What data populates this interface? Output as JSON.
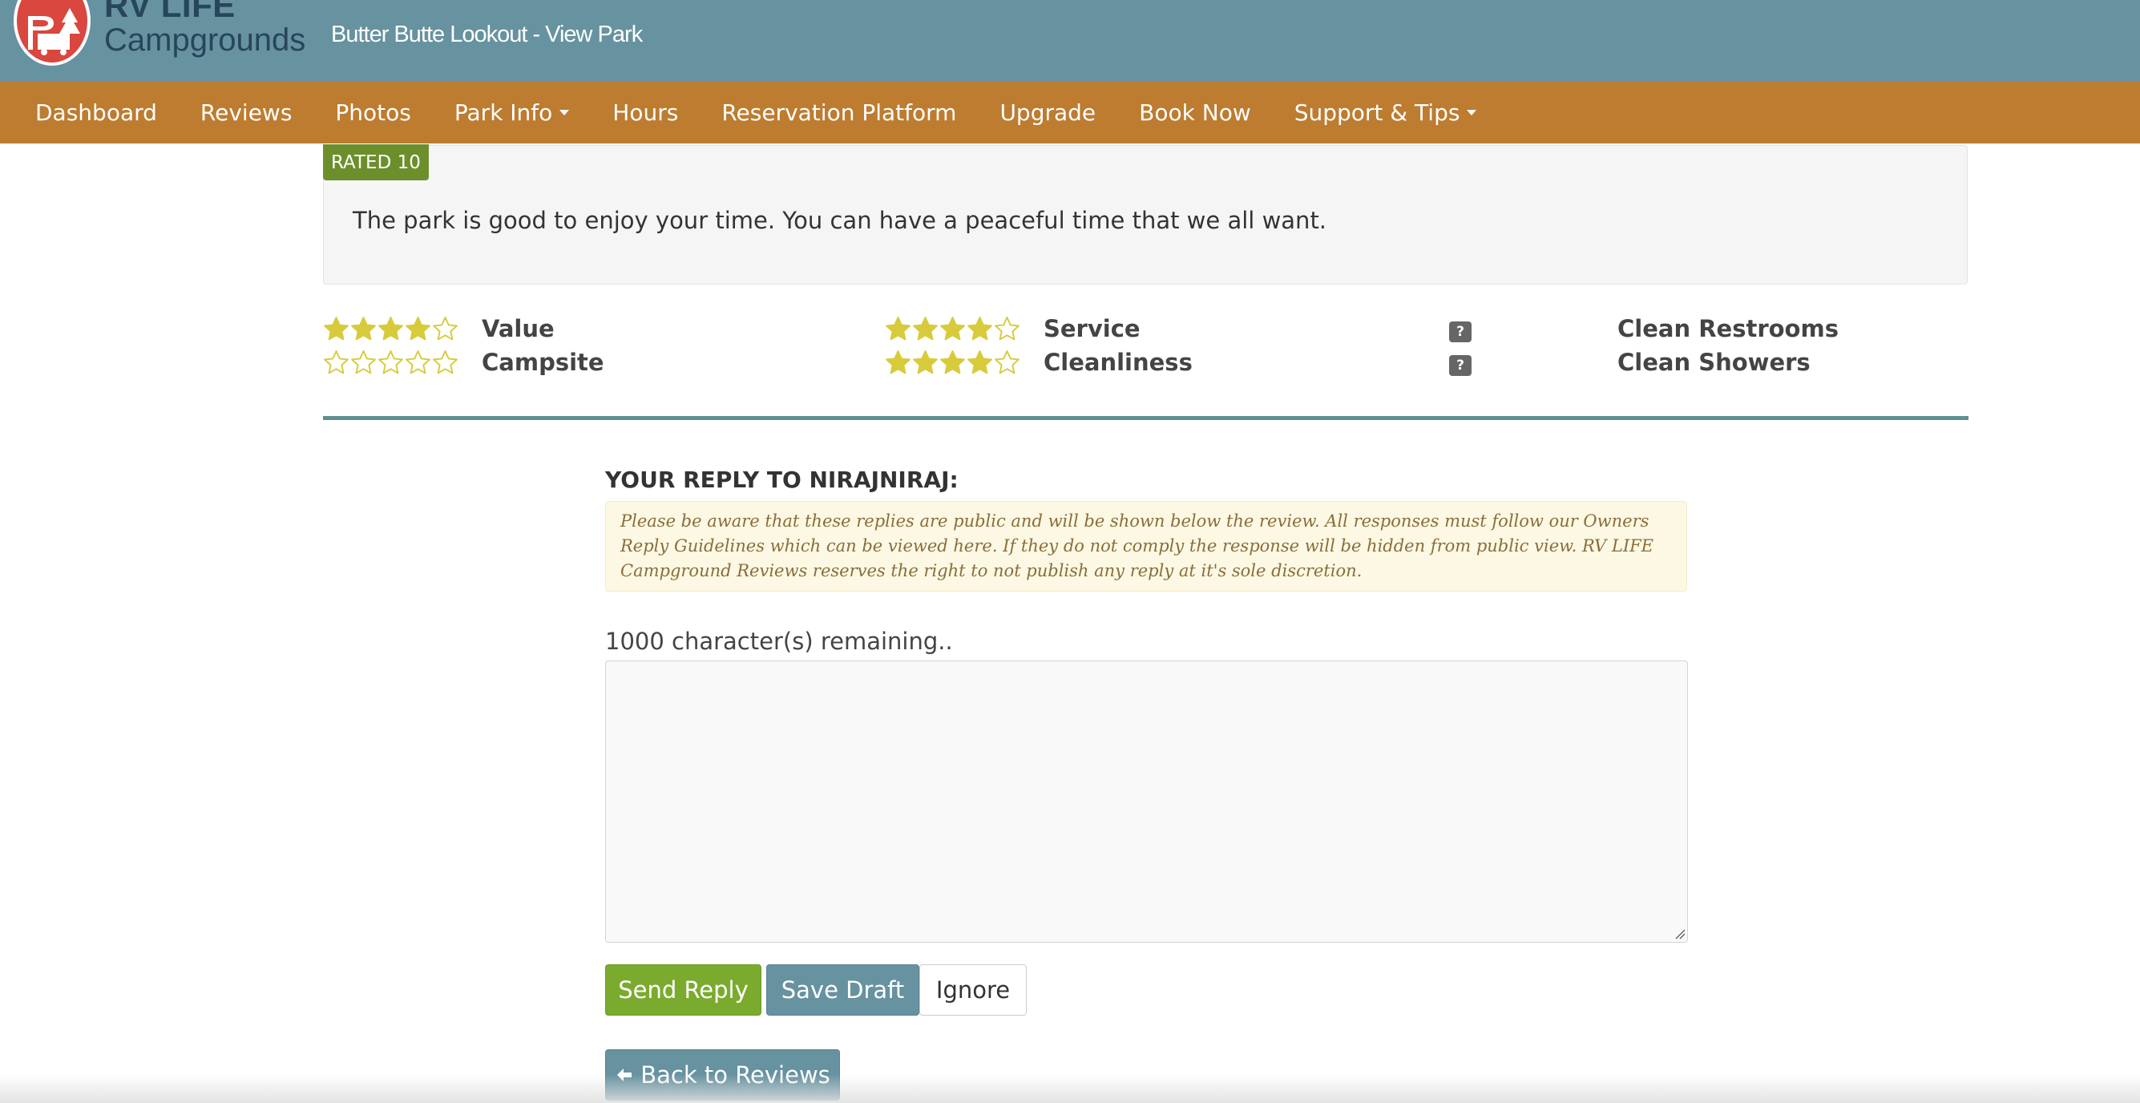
{
  "header": {
    "logo_line1": "RV LIFE",
    "logo_line2": "Campgrounds",
    "park_title": "Butter Butte Lookout - View Park",
    "bar_color": "#6792a0",
    "logo_color": "#d9473e"
  },
  "nav": {
    "color": "#bd7c30",
    "items": [
      {
        "label": "Dashboard"
      },
      {
        "label": "Reviews"
      },
      {
        "label": "Photos"
      },
      {
        "label": "Park Info",
        "dropdown": true
      },
      {
        "label": "Hours"
      },
      {
        "label": "Reservation Platform"
      },
      {
        "label": "Upgrade"
      },
      {
        "label": "Book Now"
      },
      {
        "label": "Support & Tips",
        "dropdown": true
      }
    ]
  },
  "review": {
    "rated_badge": "RATED 10",
    "text": "The park is good to enjoy your time. You can have a peaceful time that we all want."
  },
  "ratings": [
    {
      "label": "Value",
      "stars": 4,
      "max": 5
    },
    {
      "label": "Campsite",
      "stars": 0,
      "max": 5
    },
    {
      "label": "Service",
      "stars": 4,
      "max": 5
    },
    {
      "label": "Cleanliness",
      "stars": 4,
      "max": 5
    },
    {
      "label": "Clean Restrooms",
      "unknown": true
    },
    {
      "label": "Clean Showers",
      "unknown": true
    }
  ],
  "unknown_symbol": "?",
  "star_color": "#d7cb3c",
  "reply": {
    "heading": "YOUR REPLY TO NIRAJNIRAJ:",
    "notice": "Please be aware that these replies are public and will be shown below the review. All responses must follow our Owners Reply Guidelines which can be viewed here. If they do not comply the response will be hidden from public view. RV LIFE Campground Reviews reserves the right to not publish any reply at it's sole discretion.",
    "chars_remaining": "1000 character(s) remaining..",
    "textarea_value": "",
    "textarea_placeholder": ""
  },
  "buttons": {
    "send": "Send Reply",
    "draft": "Save Draft",
    "ignore": "Ignore",
    "back": "Back to Reviews"
  }
}
